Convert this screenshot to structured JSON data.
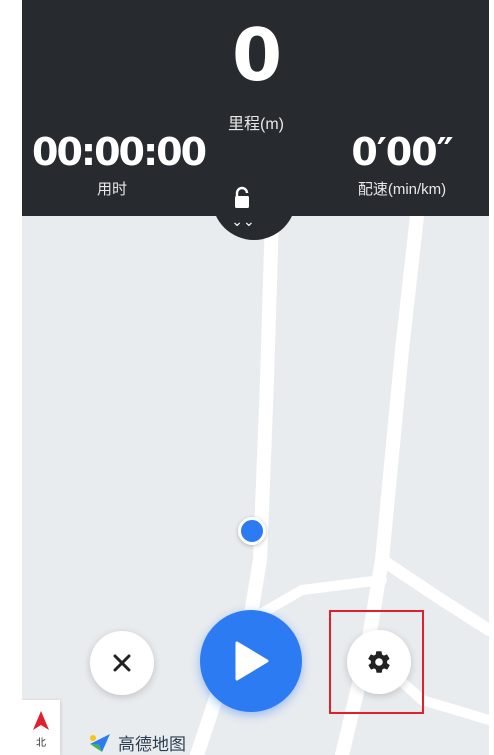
{
  "hud": {
    "top_hint": "",
    "distance": {
      "value": "0",
      "label": "里程(m)"
    },
    "time": {
      "value": "00:00:00",
      "label": "用时"
    },
    "pace": {
      "value": "0′00″",
      "label": "配速(min/km)"
    },
    "expand_glyph": "⌄⌄"
  },
  "controls": {
    "close_icon": "close-icon",
    "play_icon": "play-icon",
    "settings_icon": "gear-icon",
    "highlighted": "settings-button"
  },
  "map": {
    "compass_label": "北",
    "logo_text": "高德地图"
  },
  "colors": {
    "hud_bg": "#272a2e",
    "accent_blue": "#2d7bf2",
    "highlight_red": "#e0202e",
    "map_bg": "#e9ecef",
    "road": "#ffffff"
  }
}
